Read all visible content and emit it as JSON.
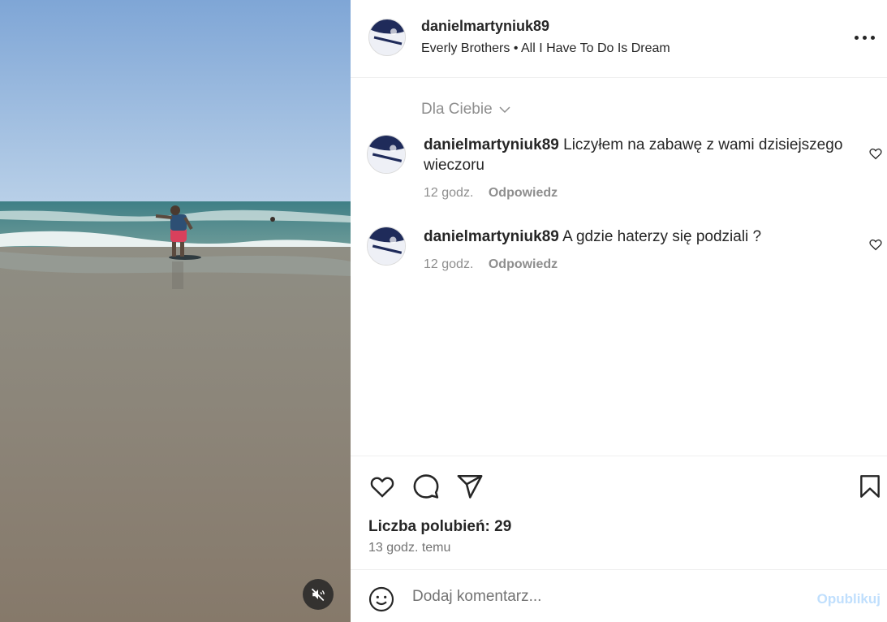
{
  "post": {
    "username": "danielmartyniuk89",
    "audio": "Everly Brothers • All I Have To Do Is Dream"
  },
  "comments_filter": "Dla Ciebie",
  "comments": [
    {
      "username": "danielmartyniuk89",
      "text": "Liczyłem na zabawę z wami dzisiejszego wieczoru",
      "time": "12 godz.",
      "reply_label": "Odpowiedz"
    },
    {
      "username": "danielmartyniuk89",
      "text": "A gdzie haterzy się podziali ?",
      "time": "12 godz.",
      "reply_label": "Odpowiedz"
    }
  ],
  "stats": {
    "likes_label": "Liczba polubień: 29",
    "posted_ago": "13 godz. temu"
  },
  "compose": {
    "placeholder": "Dodaj komentarz...",
    "publish_label": "Opublikuj"
  },
  "icons": {
    "more": "more-options-icon",
    "like": "heart-icon",
    "comment": "comment-bubble-icon",
    "share": "paper-plane-icon",
    "save": "bookmark-icon",
    "emoji": "emoji-smile-icon",
    "mute": "speaker-muted-icon",
    "chevron": "chevron-down-icon"
  },
  "colors": {
    "publish_disabled": "#c0dffd",
    "secondary_text": "#8e8e8e",
    "primary_text": "#262626"
  }
}
